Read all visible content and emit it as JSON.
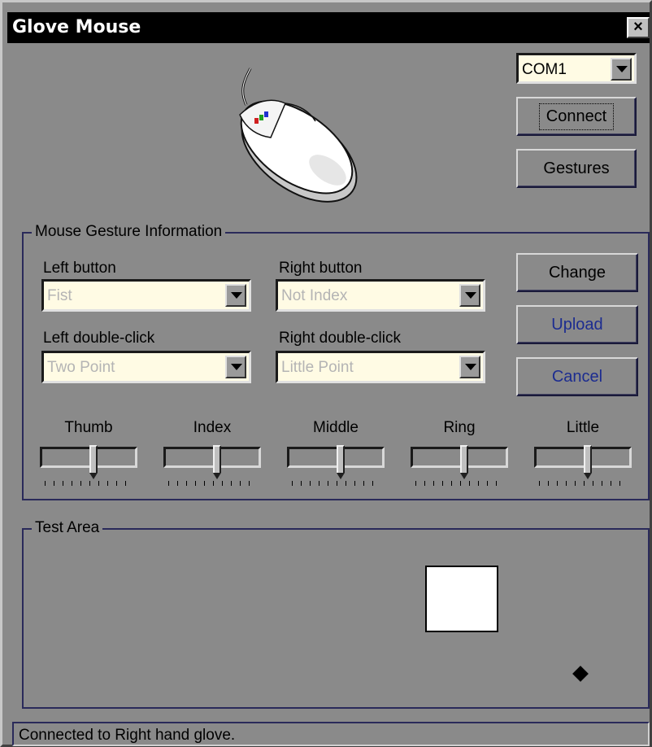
{
  "window": {
    "title": "Glove Mouse",
    "close_glyph": "×"
  },
  "port": {
    "selected": "COM1"
  },
  "buttons": {
    "connect": "Connect",
    "gestures": "Gestures",
    "change": "Change",
    "upload": "Upload",
    "cancel": "Cancel"
  },
  "gesture_group": {
    "title": "Mouse Gesture Information",
    "left_button": {
      "label": "Left button",
      "value": "Fist"
    },
    "right_button": {
      "label": "Right button",
      "value": "Not Index"
    },
    "left_double": {
      "label": "Left double-click",
      "value": "Two Point"
    },
    "right_double": {
      "label": "Right double-click",
      "value": "Little Point"
    }
  },
  "fingers": [
    {
      "name": "Thumb",
      "level": 0.55
    },
    {
      "name": "Index",
      "level": 0.55
    },
    {
      "name": "Middle",
      "level": 0.55
    },
    {
      "name": "Ring",
      "level": 0.55
    },
    {
      "name": "Little",
      "level": 0.55
    }
  ],
  "test_area": {
    "title": "Test Area"
  },
  "status": {
    "text": "Connected to Right hand glove."
  },
  "icons": {
    "mouse": "mouse-illustration-icon",
    "close": "close-icon",
    "dropdown": "chevron-down-icon"
  },
  "colors": {
    "title_bar": "#000000",
    "window_bg": "#8a8a8a",
    "combo_bg": "#fffbe4",
    "accent_text": "#1c2c90"
  }
}
